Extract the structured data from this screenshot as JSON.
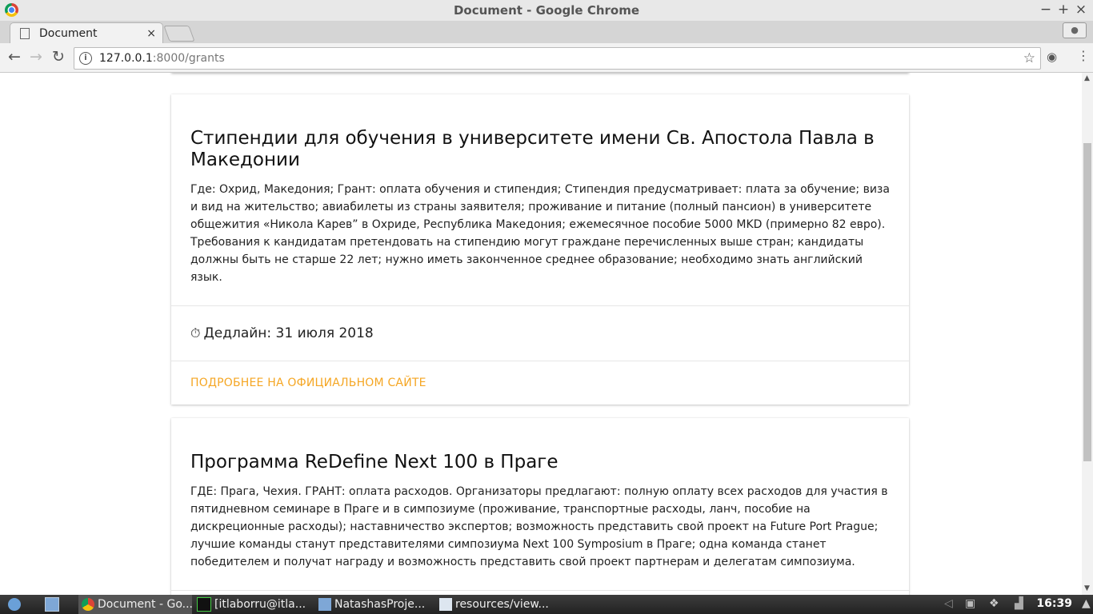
{
  "window": {
    "title": "Document - Google Chrome",
    "minimize": "−",
    "maximize": "+",
    "close": "×"
  },
  "tab": {
    "label": "Document",
    "close": "×"
  },
  "toolbar": {
    "back": "←",
    "forward": "→",
    "reload": "↻",
    "url_host": "127.0.0.1",
    "url_path": ":8000/grants",
    "star": "☆",
    "menu": "⋮"
  },
  "cards": [
    {
      "title": "Стипендии для обучения в университете имени Св. Апостола Павла в Македонии",
      "description": "Где: Охрид, Македония; Грант: оплата обучения и стипендия; Стипендия предусматривает: плата за обучение; виза и вид на жительство; авиабилеты из страны заявителя; проживание и питание (полный пансион) в университете общежития «Никола Карев” в Охриде, Республика Македония; ежемесячное пособие 5000 MKD (примерно 82 евро). Требования к кандидатам претендовать на стипендию могут граждане перечисленных выше стран; кандидаты должны быть не старше 22 лет; нужно иметь законченное среднее образование; необходимо знать английский язык.",
      "deadline": "Дедлайн: 31 июля 2018",
      "action": "ПОДРОБНЕЕ НА ОФИЦИАЛЬНОМ САЙТЕ"
    },
    {
      "title": "Программа ReDefine Next 100 в Праге",
      "description": "ГДЕ: Прага, Чехия. ГРАНТ: оплата расходов. Организаторы предлагают: полную оплату всех расходов для участия в пятидневном семинаре в Праге и в симпозиуме (проживание, транспортные расходы, ланч, пособие на дискреционные расходы); наставничество экспертов; возможность представить свой проект на Future Port Prague; лучшие команды станут представителями симпозиума Next 100 Symposium в Праге; одна команда станет победителем и получат награду и возможность представить свой проект партнерам и делегатам симпозиума."
    }
  ],
  "taskbar": {
    "items": [
      "Document - Go...",
      "[itlaborru@itla...",
      "NatashasProje...",
      "resources/view..."
    ],
    "clock": "16:39"
  },
  "colors": {
    "accent": "#f5a623",
    "taskbar": "#2b2b2b"
  }
}
